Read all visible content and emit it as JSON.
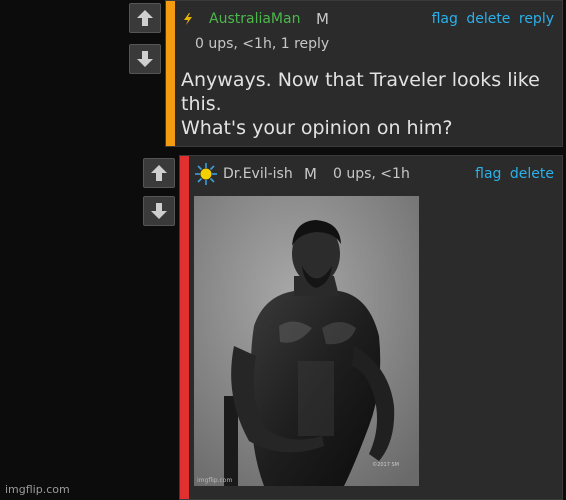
{
  "comments": [
    {
      "author": "AustraliaMan",
      "gender": "M",
      "meta": "0 ups, <1h, 1 reply",
      "links": [
        "flag",
        "delete",
        "reply"
      ],
      "text_lines": [
        "Anyways. Now that Traveler looks like",
        "this.",
        "What's your opinion on him?"
      ],
      "accent_color": "#f39c12",
      "author_color": "#4cb84c",
      "author_icon": "lightning-icon"
    },
    {
      "author": "Dr.Evil-ish",
      "gender": "M",
      "meta": "0 ups, <1h",
      "links": [
        "flag",
        "delete"
      ],
      "accent_color": "#e03030",
      "author_color": "#c9c9c9",
      "author_icon": "sun-icon",
      "image": {
        "description": "black-and-white photo of a muscular bearded man",
        "inner_watermark": "imgflip.com",
        "inner_signature": "©2017 SM"
      }
    }
  ],
  "site_watermark": "imgflip.com",
  "link_color": "#2ab0ea"
}
